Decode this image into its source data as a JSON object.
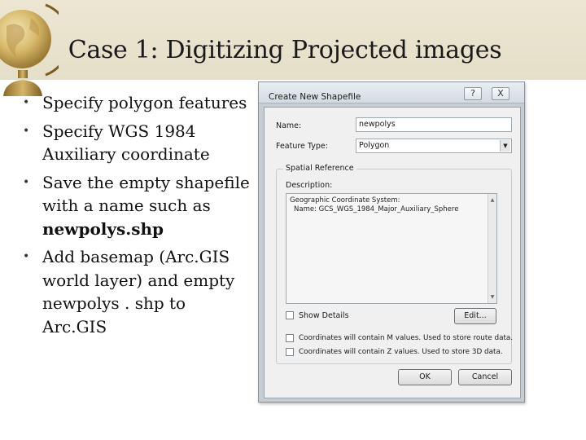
{
  "slide": {
    "title": "Case 1: Digitizing Projected images",
    "bullets": [
      {
        "text": "Specify polygon features"
      },
      {
        "text": "Specify WGS 1984 Auxiliary coordinate"
      },
      {
        "text_before": "Save the empty shapefile with a name such as ",
        "bold": "newpolys.shp"
      },
      {
        "text": " Add basemap (Arc.GIS world layer) and empty  newpolys . shp to Arc.GIS"
      }
    ]
  },
  "dialog": {
    "title": "Create New Shapefile",
    "help_glyph": "?",
    "close_glyph": "X",
    "name_label": "Name:",
    "name_value": "newpolys",
    "feature_type_label": "Feature Type:",
    "feature_type_value": "Polygon",
    "spatial_reference_label": "Spatial Reference",
    "description_label": "Description:",
    "description_line1": "Geographic Coordinate System:",
    "description_line2": "Name: GCS_WGS_1984_Major_Auxiliary_Sphere",
    "show_details_label": "Show Details",
    "edit_button": "Edit...",
    "m_values_label": "Coordinates will contain M values. Used to store route data.",
    "z_values_label": "Coordinates will contain Z values. Used to store 3D data.",
    "ok_button": "OK",
    "cancel_button": "Cancel"
  }
}
